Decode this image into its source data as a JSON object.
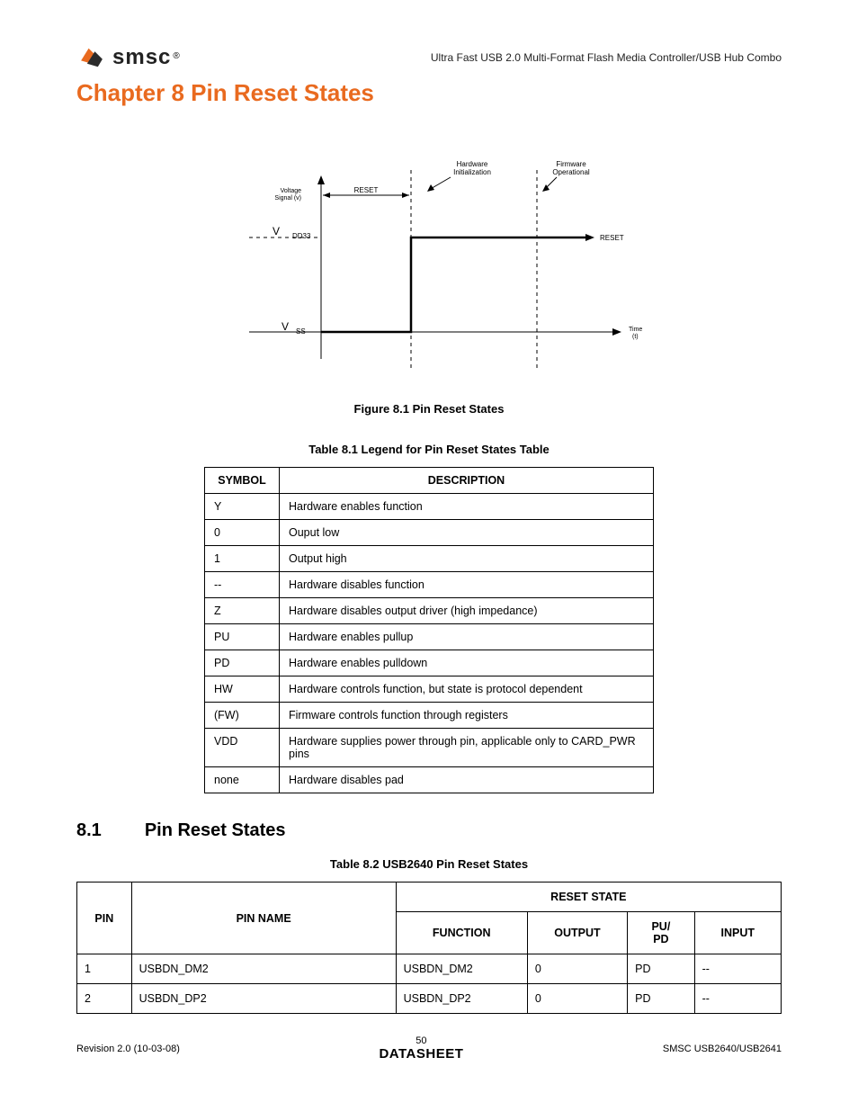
{
  "header": {
    "logo_text": "smsc",
    "logo_reg": "®",
    "subtitle": "Ultra Fast USB 2.0 Multi-Format Flash Media Controller/USB Hub Combo"
  },
  "chapter": {
    "title": "Chapter 8 Pin Reset States"
  },
  "figure": {
    "caption": "Figure 8.1 Pin Reset States",
    "labels": {
      "voltage_signal": "Voltage\nSignal (v)",
      "reset_span": "RESET",
      "hw_init": "Hardware\nInitialization",
      "fw_op": "Firmware\nOperational",
      "vdd33_base": "V",
      "vdd33_sub": "DD33",
      "vss_base": "V",
      "vss_sub": "SS",
      "reset_line": "RESET",
      "time": "Time\n(t)"
    }
  },
  "table_legend": {
    "caption": "Table 8.1  Legend for Pin Reset States Table",
    "headers": {
      "symbol": "SYMBOL",
      "description": "DESCRIPTION"
    },
    "rows": [
      {
        "symbol": "Y",
        "description": "Hardware enables function"
      },
      {
        "symbol": "0",
        "description": "Ouput low"
      },
      {
        "symbol": "1",
        "description": "Output high"
      },
      {
        "symbol": "--",
        "description": "Hardware disables function"
      },
      {
        "symbol": "Z",
        "description": "Hardware disables output driver (high impedance)"
      },
      {
        "symbol": "PU",
        "description": "Hardware enables pullup"
      },
      {
        "symbol": "PD",
        "description": "Hardware enables pulldown"
      },
      {
        "symbol": "HW",
        "description": "Hardware controls function, but state is protocol dependent"
      },
      {
        "symbol": "(FW)",
        "description": "Firmware controls function through registers"
      },
      {
        "symbol": "VDD",
        "description": "Hardware supplies power through pin, applicable only to CARD_PWR pins"
      },
      {
        "symbol": "none",
        "description": "Hardware disables pad"
      }
    ]
  },
  "section": {
    "number": "8.1",
    "title": "Pin Reset States"
  },
  "table_pins": {
    "caption": "Table 8.2  USB2640 Pin Reset States",
    "headers": {
      "reset_state": "RESET STATE",
      "pin": "PIN",
      "pin_name": "PIN NAME",
      "function": "FUNCTION",
      "output": "OUTPUT",
      "pupd": "PU/\nPD",
      "input": "INPUT"
    },
    "rows": [
      {
        "pin": "1",
        "name": "USBDN_DM2",
        "function": "USBDN_DM2",
        "output": "0",
        "pupd": "PD",
        "input": "--"
      },
      {
        "pin": "2",
        "name": "USBDN_DP2",
        "function": "USBDN_DP2",
        "output": "0",
        "pupd": "PD",
        "input": "--"
      }
    ]
  },
  "footer": {
    "left": "Revision 2.0 (10-03-08)",
    "page": "50",
    "datasheet": "DATASHEET",
    "right": "SMSC USB2640/USB2641"
  }
}
